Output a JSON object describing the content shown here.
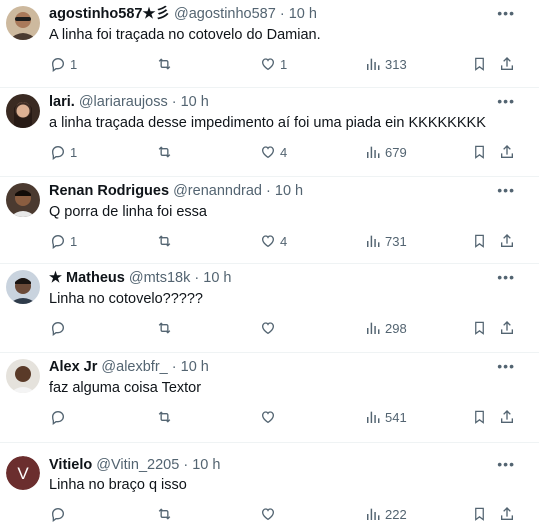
{
  "replies": [
    {
      "name": "agostinho587★彡",
      "handle": "@agostinho587",
      "sep": "·",
      "time": "10 h",
      "text": "A linha foi traçada no cotovelo do Damian.",
      "reply_count": "1",
      "retweet_count": "",
      "like_count": "1",
      "view_count": "313",
      "avatar_bg": "#b89a7a"
    },
    {
      "name": "lari.",
      "handle": "@lariaraujoss",
      "sep": "·",
      "time": "10 h",
      "text": "a linha traçada desse impedimento aí foi uma piada ein KKKKKKKK",
      "reply_count": "1",
      "retweet_count": "",
      "like_count": "4",
      "view_count": "679",
      "avatar_bg": "#3a2a22"
    },
    {
      "name": "Renan Rodrigues",
      "handle": "@renanndrad",
      "sep": "·",
      "time": "10 h",
      "text": "Q porra de linha foi essa",
      "reply_count": "1",
      "retweet_count": "",
      "like_count": "4",
      "view_count": "731",
      "avatar_bg": "#2c2420"
    },
    {
      "name": "★ Matheus",
      "handle": "@mts18k",
      "sep": "·",
      "time": "10 h",
      "text": "Linha no cotovelo?????",
      "reply_count": "",
      "retweet_count": "",
      "like_count": "",
      "view_count": "298",
      "avatar_bg": "#c9d3de"
    },
    {
      "name": "Alex Jr",
      "handle": "@alexbfr_",
      "sep": "·",
      "time": "10 h",
      "text": "faz alguma coisa Textor",
      "reply_count": "",
      "retweet_count": "",
      "like_count": "",
      "view_count": "541",
      "avatar_bg": "#e5e2dc"
    },
    {
      "name": "Vitielo",
      "handle": "@Vitin_2205",
      "sep": "·",
      "time": "10 h",
      "text": "Linha no braço q isso",
      "reply_count": "",
      "retweet_count": "",
      "like_count": "",
      "view_count": "222",
      "avatar_bg": "#6b2e2e",
      "avatar_letter": "V"
    }
  ],
  "icons": {
    "reply": "reply-icon",
    "retweet": "retweet-icon",
    "like": "heart-icon",
    "views": "views-icon",
    "bookmark": "bookmark-icon",
    "share": "share-icon",
    "more": "more-icon"
  },
  "colors": {
    "text": "#0f1419",
    "meta": "#536471",
    "divider": "#eff3f4"
  }
}
